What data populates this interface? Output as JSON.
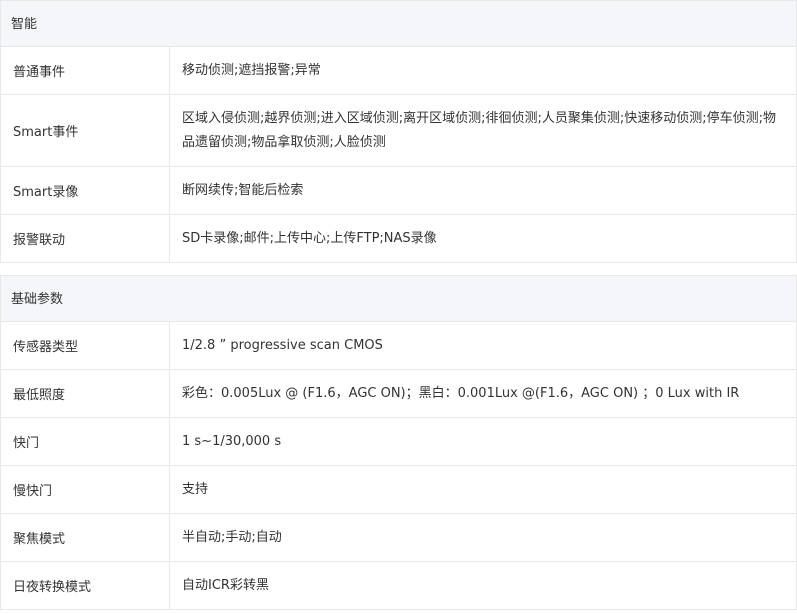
{
  "smart": {
    "title": "智能",
    "rows": [
      {
        "label": "普通事件",
        "value": "移动侦测;遮挡报警;异常"
      },
      {
        "label": "Smart事件",
        "value": "区域入侵侦测;越界侦测;进入区域侦测;离开区域侦测;徘徊侦测;人员聚集侦测;快速移动侦测;停车侦测;物品遗留侦测;物品拿取侦测;人脸侦测"
      },
      {
        "label": "Smart录像",
        "value": "断网续传;智能后检索"
      },
      {
        "label": "报警联动",
        "value": "SD卡录像;邮件;上传中心;上传FTP;NAS录像"
      }
    ]
  },
  "basic": {
    "title": "基础参数",
    "rows": [
      {
        "label": "传感器类型",
        "value": "1/2.8 ” progressive scan CMOS"
      },
      {
        "label": "最低照度",
        "value": "彩色：0.005Lux @ (F1.6，AGC ON)；黑白：0.001Lux @(F1.6，AGC ON) ；0 Lux with IR"
      },
      {
        "label": "快门",
        "value": "1 s~1/30,000 s"
      },
      {
        "label": "慢快门",
        "value": "支持"
      },
      {
        "label": "聚焦模式",
        "value": "半自动;手动;自动"
      },
      {
        "label": "日夜转换模式",
        "value": "自动ICR彩转黑"
      }
    ]
  }
}
